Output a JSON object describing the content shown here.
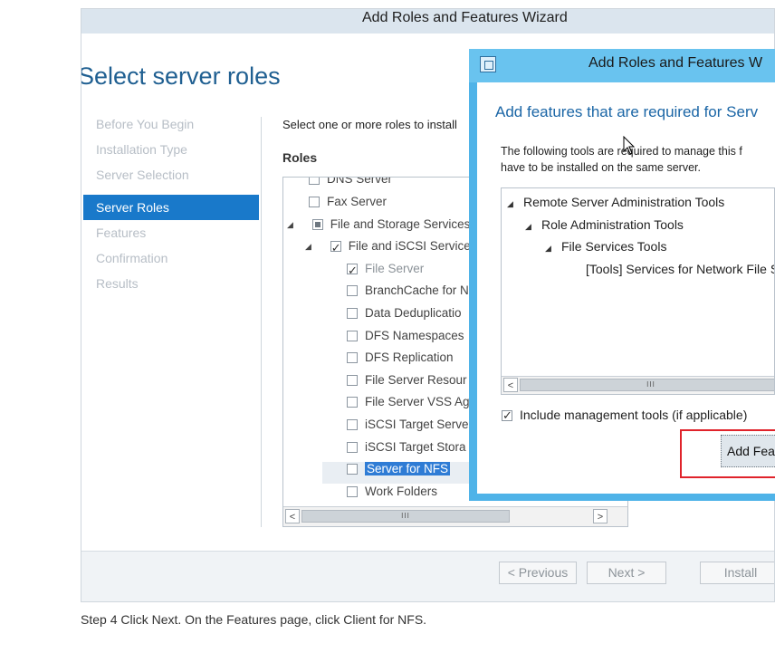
{
  "wizard": {
    "title": "Add Roles and Features Wizard",
    "heading": "Select server roles",
    "nav": [
      "Before You Begin",
      "Installation Type",
      "Server Selection",
      "Server Roles",
      "Features",
      "Confirmation",
      "Results"
    ],
    "instruction": "Select one or more roles to install",
    "roles_label": "Roles",
    "roles": [
      {
        "label": "DNS Server",
        "level": 0,
        "expander": "",
        "check": "none"
      },
      {
        "label": "Fax Server",
        "level": 0,
        "expander": "",
        "check": "none"
      },
      {
        "label": "File and Storage Services",
        "level": 0,
        "expander": "◢",
        "check": "partial"
      },
      {
        "label": "File and iSCSI Services",
        "level": 1,
        "expander": "◢",
        "check": "checked"
      },
      {
        "label": "File Server",
        "level": 2,
        "expander": "",
        "check": "checked"
      },
      {
        "label": "BranchCache for N",
        "level": 2,
        "expander": "",
        "check": "none"
      },
      {
        "label": "Data Deduplicatio",
        "level": 2,
        "expander": "",
        "check": "none"
      },
      {
        "label": "DFS Namespaces",
        "level": 2,
        "expander": "",
        "check": "none"
      },
      {
        "label": "DFS Replication",
        "level": 2,
        "expander": "",
        "check": "none"
      },
      {
        "label": "File Server Resour",
        "level": 2,
        "expander": "",
        "check": "none"
      },
      {
        "label": "File Server VSS Ag",
        "level": 2,
        "expander": "",
        "check": "none"
      },
      {
        "label": "iSCSI Target Serve",
        "level": 2,
        "expander": "",
        "check": "none"
      },
      {
        "label": "iSCSI Target Stora",
        "level": 2,
        "expander": "",
        "check": "none"
      },
      {
        "label": "Server for NFS",
        "level": 2,
        "expander": "",
        "check": "none"
      },
      {
        "label": "Work Folders",
        "level": 2,
        "expander": "",
        "check": "none"
      }
    ],
    "scroll": {
      "left": "<",
      "right": ">",
      "grip": "III"
    },
    "buttons": {
      "previous": "< Previous",
      "next": "Next >",
      "install": "Install"
    }
  },
  "dialog": {
    "title": "Add Roles and Features W",
    "heading": "Add features that are required for Serv",
    "desc_line1": "The following tools are required to manage this f",
    "desc_line2": "have to be installed on the same server.",
    "tree": [
      {
        "label": "Remote Server Administration Tools",
        "expander": "◢"
      },
      {
        "label": "Role Administration Tools",
        "expander": "◢"
      },
      {
        "label": "File Services Tools",
        "expander": "◢"
      },
      {
        "label": "[Tools] Services for Network File S",
        "expander": ""
      }
    ],
    "include_label": "Include management tools (if applicable)",
    "include_checked": true,
    "add_button": "Add Feat",
    "scroll": {
      "left": "<",
      "grip": "III"
    }
  },
  "caption": "Step 4 Click Next. On the Features page, click Client for NFS."
}
